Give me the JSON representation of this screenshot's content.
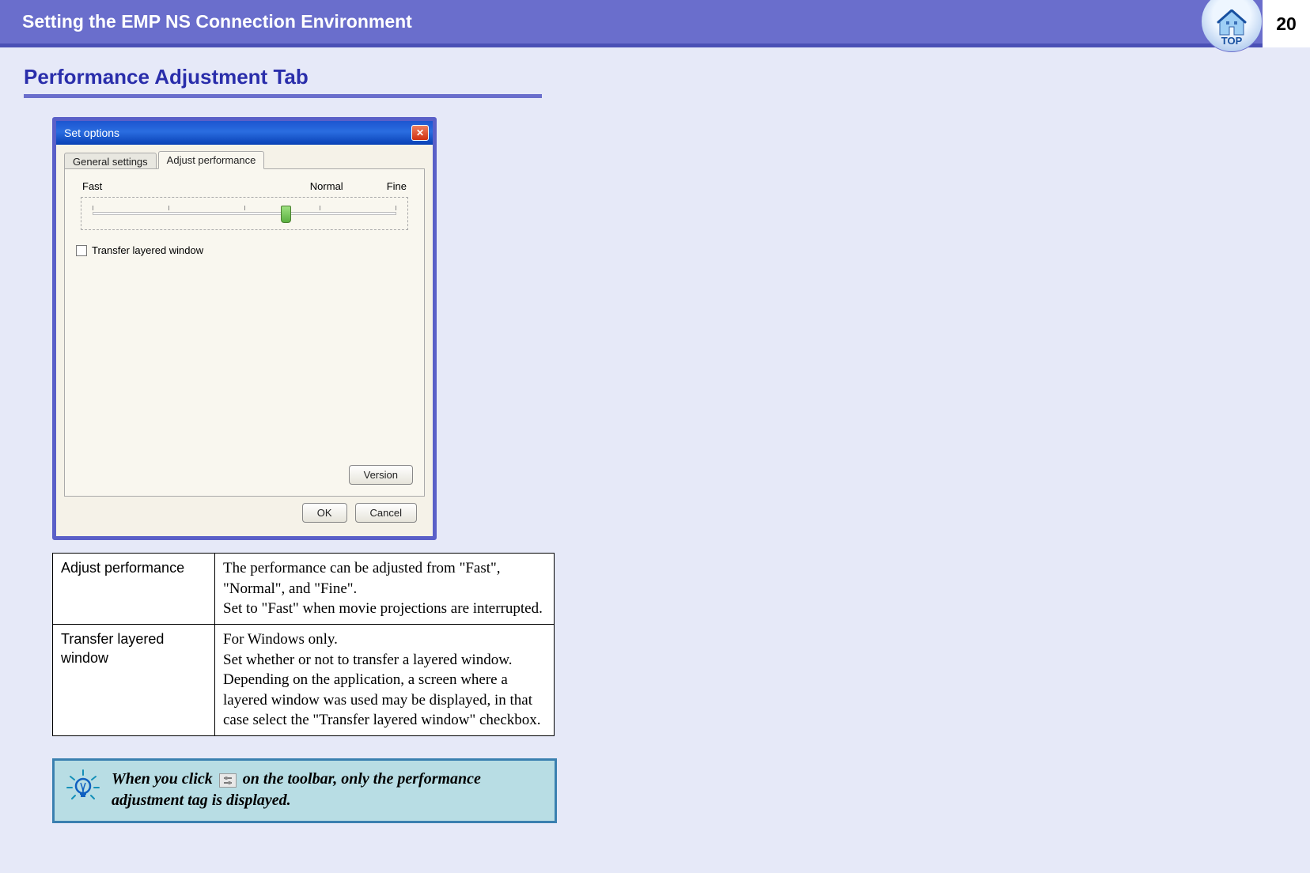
{
  "header": {
    "title": "Setting the EMP NS Connection Environment",
    "page_number": "20",
    "top_badge_label": "TOP"
  },
  "section": {
    "heading": "Performance Adjustment Tab"
  },
  "dialog": {
    "title": "Set options",
    "tabs": {
      "general": "General settings",
      "adjust": "Adjust performance"
    },
    "slider": {
      "fast": "Fast",
      "normal": "Normal",
      "fine": "Fine"
    },
    "checkbox_label": "Transfer layered window",
    "buttons": {
      "version": "Version",
      "ok": "OK",
      "cancel": "Cancel"
    }
  },
  "table": {
    "rows": [
      {
        "key": "Adjust performance",
        "value": "The performance can be adjusted from \"Fast\", \"Normal\", and \"Fine\".\nSet to \"Fast\" when movie projections are interrupted."
      },
      {
        "key": "Transfer layered window",
        "value": "For Windows only.\nSet whether or not to transfer a layered window. Depending on the application, a screen where a layered window was used may be displayed, in that case select the \"Transfer layered window\" checkbox."
      }
    ]
  },
  "tip": {
    "text_before": "When you click ",
    "text_after": " on the toolbar, only the performance adjustment tag is displayed."
  }
}
